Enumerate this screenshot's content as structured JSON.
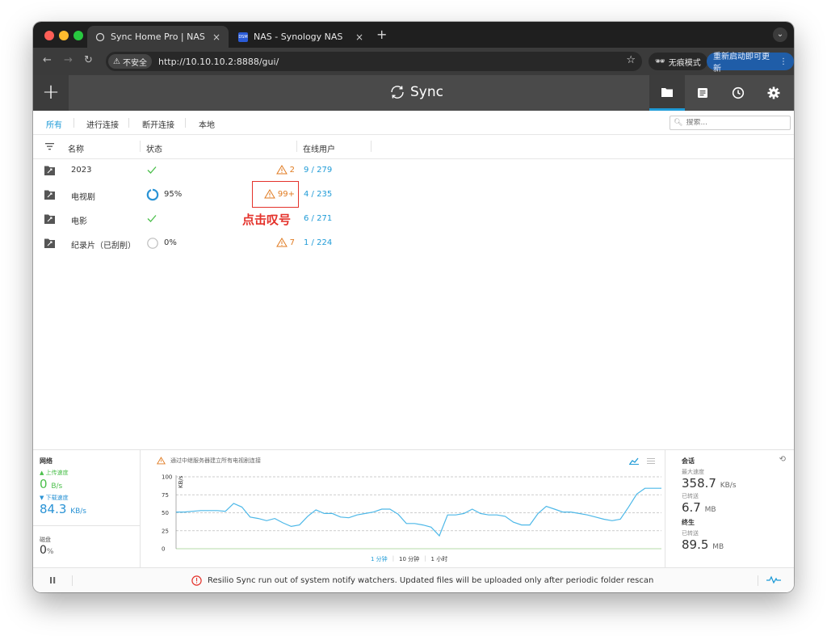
{
  "browser": {
    "tabs": [
      {
        "title": "Sync Home Pro | NAS",
        "close": "×"
      },
      {
        "title": "NAS - Synology NAS",
        "favicon_text": "DSM",
        "close": "×"
      }
    ],
    "new_tab": "+",
    "tab_menu": "⌄",
    "security_label": "不安全",
    "url": "http://10.10.10.2:8888/gui/",
    "incognito_label": "无痕模式",
    "update_label": "重新启动即可更新",
    "update_more": "⋮"
  },
  "app": {
    "logo_text": "Sync",
    "add_label": "+"
  },
  "filters": {
    "items": [
      "所有",
      "进行连接",
      "断开连接",
      "本地"
    ],
    "active": "所有",
    "search_placeholder": "搜索..."
  },
  "table": {
    "headers": {
      "name": "名称",
      "status": "状态",
      "peers": "在线用户"
    },
    "rows": [
      {
        "name": "2023",
        "status": "synced",
        "percent": "",
        "warnings": "2",
        "peers": "9 / 279"
      },
      {
        "name": "电视剧",
        "status": "syncing",
        "percent": "95%",
        "warnings": "99+",
        "peers": "4 / 235"
      },
      {
        "name": "电影",
        "status": "synced",
        "percent": "",
        "warnings": "",
        "peers": "6 / 271"
      },
      {
        "name": "纪录片（已刮削）",
        "status": "idle",
        "percent": "0%",
        "warnings": "7",
        "peers": "1 / 224"
      }
    ]
  },
  "annotation": {
    "text": "点击叹号"
  },
  "stats": {
    "network": {
      "title": "网络",
      "upload_label": "▲ 上传速度",
      "upload_value": "0",
      "upload_unit": "B/s",
      "download_label": "▼ 下载速度",
      "download_value": "84.3",
      "download_unit": "KB/s"
    },
    "disk": {
      "title": "磁盘",
      "value": "0",
      "unit": "%"
    },
    "chart_notice": "通过中继服务器建立所有电视剧连接",
    "time_ranges": [
      "1 分钟",
      "10 分钟",
      "1 小时"
    ],
    "active_range": "1 分钟",
    "session": {
      "title": "会话",
      "max_speed_label": "最大速度",
      "max_speed_value": "358.7",
      "max_speed_unit": "KB/s",
      "transferred_label": "已转送",
      "transferred_value": "6.7",
      "transferred_unit": "MB"
    },
    "lifetime": {
      "title": "终生",
      "transferred_label": "已转送",
      "transferred_value": "89.5",
      "transferred_unit": "MB"
    }
  },
  "chart_data": {
    "type": "line",
    "ylabel": "KB/s",
    "ylim": [
      0,
      100
    ],
    "yticks": [
      0,
      25,
      50,
      75,
      100
    ],
    "grid": true,
    "x": [
      0,
      1,
      2,
      3,
      4,
      5,
      6,
      7,
      8,
      9,
      10,
      11,
      12,
      13,
      14,
      15,
      16,
      17,
      18,
      19,
      20,
      21,
      22,
      23,
      24,
      25,
      26,
      27,
      28,
      29,
      30,
      31,
      32,
      33,
      34,
      35,
      36,
      37,
      38,
      39,
      40,
      41,
      42,
      43,
      44,
      45,
      46,
      47,
      48,
      49,
      50,
      51,
      52,
      53,
      54,
      55,
      56,
      57,
      58,
      59
    ],
    "series": [
      {
        "values": [
          51,
          51,
          52,
          53,
          53,
          53,
          52,
          63,
          58,
          44,
          42,
          39,
          42,
          36,
          31,
          33,
          45,
          54,
          49,
          49,
          44,
          43,
          47,
          49,
          51,
          55,
          55,
          48,
          35,
          35,
          33,
          30,
          18,
          47,
          47,
          49,
          55,
          49,
          47,
          47,
          45,
          37,
          33,
          33,
          49,
          59,
          55,
          51,
          51,
          49,
          47,
          44,
          41,
          39,
          41,
          58,
          76,
          84,
          84,
          84
        ]
      }
    ]
  },
  "footer": {
    "pause": "II",
    "message": "Resilio Sync run out of system notify watchers. Updated files will be uploaded only after periodic folder rescan"
  },
  "colors": {
    "accent": "#1f9bd7",
    "warning": "#e07a1f",
    "error": "#e4322b",
    "ok": "#4bbf4b"
  }
}
